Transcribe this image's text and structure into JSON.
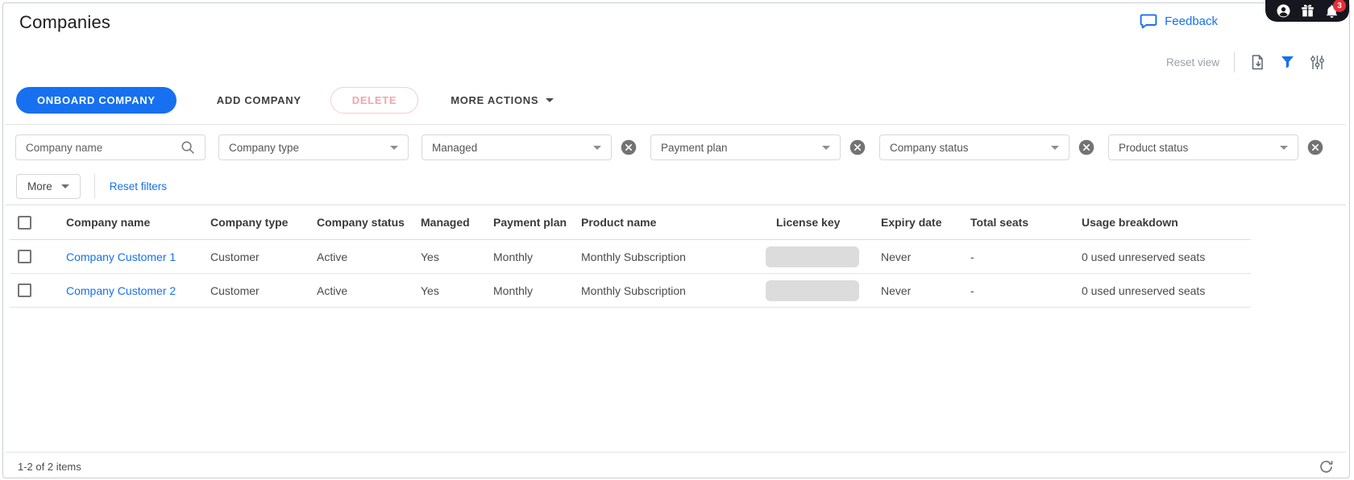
{
  "page": {
    "title": "Companies"
  },
  "top_bar": {
    "feedback_label": "Feedback",
    "notification_count": "3"
  },
  "view_controls": {
    "reset_view_label": "Reset view"
  },
  "actions": {
    "onboard_label": "ONBOARD COMPANY",
    "add_label": "ADD COMPANY",
    "delete_label": "DELETE",
    "more_actions_label": "MORE ACTIONS"
  },
  "filters": {
    "search_placeholder": "Company name",
    "dropdowns": [
      {
        "label": "Company type",
        "clearable": false
      },
      {
        "label": "Managed",
        "clearable": true
      },
      {
        "label": "Payment plan",
        "clearable": true
      },
      {
        "label": "Company status",
        "clearable": true
      },
      {
        "label": "Product status",
        "clearable": true
      }
    ],
    "more_label": "More",
    "reset_filters_label": "Reset filters"
  },
  "table": {
    "columns": [
      "Company name",
      "Company type",
      "Company status",
      "Managed",
      "Payment plan",
      "Product name",
      "License key",
      "Expiry date",
      "Total seats",
      "Usage breakdown"
    ],
    "rows": [
      {
        "company_name": "Company Customer 1",
        "company_type": "Customer",
        "company_status": "Active",
        "managed": "Yes",
        "payment_plan": "Monthly",
        "product_name": "Monthly Subscription",
        "license_key_redacted": true,
        "expiry_date": "Never",
        "total_seats": "-",
        "usage_breakdown": "0 used unreserved seats"
      },
      {
        "company_name": "Company Customer 2",
        "company_type": "Customer",
        "company_status": "Active",
        "managed": "Yes",
        "payment_plan": "Monthly",
        "product_name": "Monthly Subscription",
        "license_key_redacted": true,
        "expiry_date": "Never",
        "total_seats": "-",
        "usage_breakdown": "0 used unreserved seats"
      }
    ]
  },
  "footer": {
    "items_label": "1-2 of 2 items"
  },
  "colors": {
    "accent_blue": "#1670f0",
    "delete_pink": "#f0a6ad",
    "badge_red": "#e62e38",
    "pill_dark": "#16171e"
  }
}
